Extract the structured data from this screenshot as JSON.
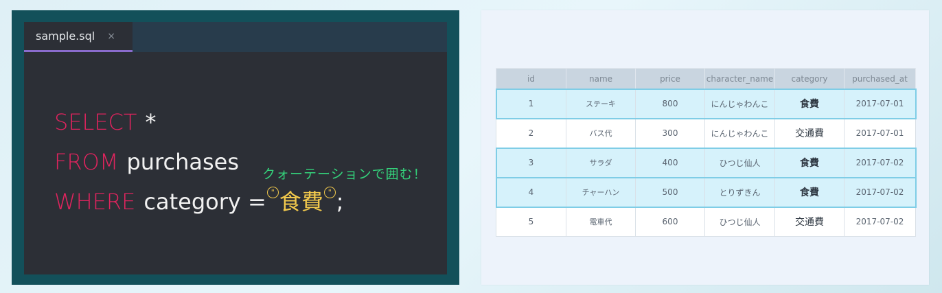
{
  "editor": {
    "tab_label": "sample.sql",
    "tab_close": "×",
    "lines": [
      {
        "keyword": "SELECT",
        "rest": "*"
      },
      {
        "keyword": "FROM",
        "rest": "purchases"
      },
      {
        "keyword": "WHERE",
        "rest": "category =",
        "quote": "\"",
        "literal": "食費",
        "end": ";"
      }
    ],
    "annotation": "クォーテーションで囲む！"
  },
  "colors": {
    "keyword": "#e0245e",
    "literal": "#f2c94c",
    "annotation": "#34d27b",
    "highlight_row": "#d6f2fb"
  },
  "table": {
    "headers": [
      "id",
      "name",
      "price",
      "character_name",
      "category",
      "purchased_at"
    ],
    "rows": [
      {
        "id": "1",
        "name": "ステーキ",
        "price": "800",
        "character_name": "にんじゃわんこ",
        "category": "食費",
        "purchased_at": "2017-07-01",
        "highlighted": true
      },
      {
        "id": "2",
        "name": "バス代",
        "price": "300",
        "character_name": "にんじゃわんこ",
        "category": "交通費",
        "purchased_at": "2017-07-01",
        "highlighted": false
      },
      {
        "id": "3",
        "name": "サラダ",
        "price": "400",
        "character_name": "ひつじ仙人",
        "category": "食費",
        "purchased_at": "2017-07-02",
        "highlighted": true
      },
      {
        "id": "4",
        "name": "チャーハン",
        "price": "500",
        "character_name": "とりずきん",
        "category": "食費",
        "purchased_at": "2017-07-02",
        "highlighted": true
      },
      {
        "id": "5",
        "name": "電車代",
        "price": "600",
        "character_name": "ひつじ仙人",
        "category": "交通費",
        "purchased_at": "2017-07-02",
        "highlighted": false
      }
    ]
  }
}
